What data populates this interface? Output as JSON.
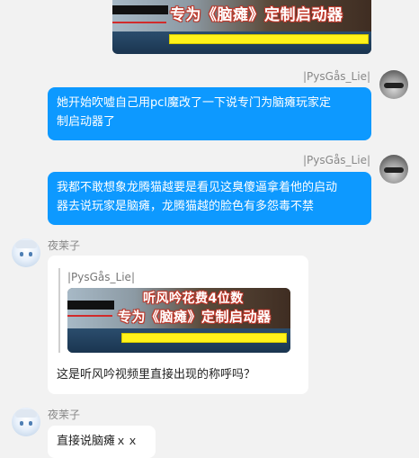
{
  "top_image": {
    "line1": "专为《脑瘫》定制启动器"
  },
  "messages": [
    {
      "sender": "|PysGås_Lie|",
      "text_line1": "她开始吹嘘自己用pcl魔改了一下说专门为脑瘫玩家定",
      "text_line2": "制启动器了"
    },
    {
      "sender": "|PysGås_Lie|",
      "text_line1": "我都不敢想象龙腾猫越要是看见这臭傻逼拿着他的启动",
      "text_line2": "器去说玩家是脑瘫，龙腾猫越的脸色有多怨毒不禁"
    },
    {
      "sender": "夜茉子",
      "quote_sender": "|PysGås_Lie|",
      "quote_image_line1": "听风吟花费4位数",
      "quote_image_line2": "专为《脑瘫》定制启动器",
      "text": "这是听风吟视频里直接出现的称呼吗？"
    },
    {
      "sender": "夜茉子",
      "text": "直接说脑瘫ｘｘ"
    }
  ]
}
